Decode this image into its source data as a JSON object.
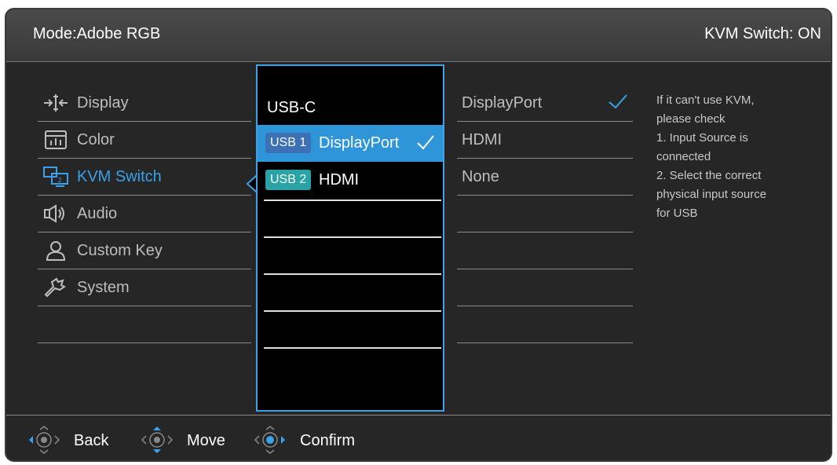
{
  "header": {
    "mode": "Mode:Adobe RGB",
    "kvm_status": "KVM Switch: ON"
  },
  "menu": {
    "items": [
      {
        "label": "Display",
        "icon": "display-adjust-icon"
      },
      {
        "label": "Color",
        "icon": "color-chart-icon"
      },
      {
        "label": "KVM Switch",
        "icon": "kvm-screens-icon",
        "active": true
      },
      {
        "label": "Audio",
        "icon": "speaker-icon"
      },
      {
        "label": "Custom Key",
        "icon": "user-icon"
      },
      {
        "label": "System",
        "icon": "wrench-icon"
      }
    ]
  },
  "submenu": {
    "items": [
      {
        "label": "USB-C"
      },
      {
        "badge": "USB 1",
        "label": "DisplayPort",
        "selected": true,
        "checked": true
      },
      {
        "badge": "USB 2",
        "label": "HDMI"
      }
    ]
  },
  "options": {
    "items": [
      {
        "label": "DisplayPort",
        "checked": true
      },
      {
        "label": "HDMI"
      },
      {
        "label": "None"
      }
    ]
  },
  "help": {
    "lines": [
      "If it can't use KVM,",
      "please check",
      "1. Input Source is",
      "connected",
      "2. Select the correct",
      "physical input source",
      "for USB"
    ]
  },
  "footer": {
    "back": "Back",
    "move": "Move",
    "confirm": "Confirm"
  },
  "colors": {
    "accent": "#2e95d9",
    "usb1_badge": "#3d71b6",
    "usb2_badge": "#2aa3a6",
    "panel": "#262626"
  }
}
